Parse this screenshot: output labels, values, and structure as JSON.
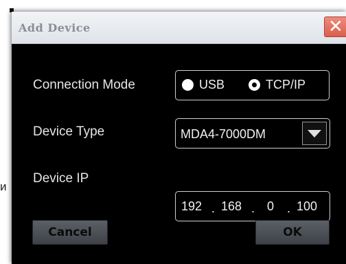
{
  "background": {
    "fragment_text": "и"
  },
  "dialog": {
    "title": "Add Device",
    "close_symbol": "✕",
    "connection_mode": {
      "label": "Connection Mode",
      "options": [
        "USB",
        "TCP/IP"
      ],
      "selected": "TCP/IP"
    },
    "device_type": {
      "label": "Device Type",
      "value": "MDA4-7000DM"
    },
    "device_ip": {
      "label": "Device IP",
      "octets": [
        "192",
        "168",
        "0",
        "100"
      ],
      "separator": "."
    },
    "buttons": {
      "cancel": "Cancel",
      "ok": "OK"
    }
  }
}
